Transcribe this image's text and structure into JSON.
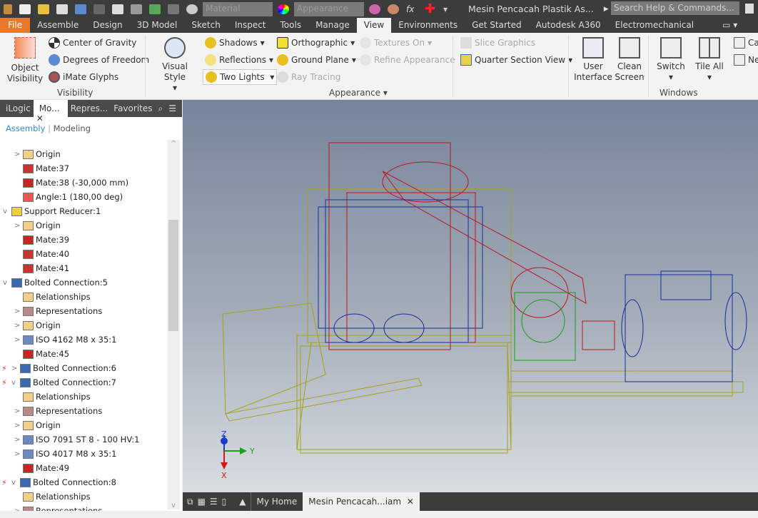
{
  "app": {
    "title": "Mesin Pencacah Plastik As...",
    "search_placeholder": "Search Help & Commands...",
    "material": "Material",
    "appearance": "Appearance"
  },
  "tabs": [
    "File",
    "Assemble",
    "Design",
    "3D Model",
    "Sketch",
    "Inspect",
    "Tools",
    "Manage",
    "View",
    "Environments",
    "Get Started",
    "Autodesk A360",
    "Electromechanical"
  ],
  "ribbon": {
    "object_visibility": "Object Visibility",
    "center_of_gravity": "Center of Gravity",
    "degrees_of_freedom": "Degrees of Freedom",
    "imate_glyphs": "iMate Glyphs",
    "visibility_group": "Visibility",
    "visual_style": "Visual Style",
    "shadows": "Shadows",
    "reflections": "Reflections",
    "two_lights": "Two Lights",
    "orthographic": "Orthographic",
    "ground_plane": "Ground Plane",
    "ray_tracing": "Ray Tracing",
    "textures_on": "Textures On",
    "refine_appearance": "Refine Appearance",
    "slice_graphics": "Slice Graphics",
    "quarter_section": "Quarter Section View",
    "appearance_group": "Appearance ▾",
    "user_interface": "User Interface",
    "clean_screen": "Clean Screen",
    "switch": "Switch",
    "tile_all": "Tile All",
    "cascade": "Ca",
    "new": "Ne",
    "windows_group": "Windows"
  },
  "browser": {
    "tabs": [
      "iLogic",
      "Mo...",
      "Repres...",
      "Favorites"
    ],
    "assembly": "Assembly",
    "modeling": "Modeling",
    "items": [
      {
        "label": "Origin",
        "level": 1,
        "icon": "folder",
        "chev": ">"
      },
      {
        "label": "Mate:37",
        "level": 1,
        "icon": "mate"
      },
      {
        "label": "Mate:38 (-30,000 mm)",
        "level": 1,
        "icon": "flush"
      },
      {
        "label": "Angle:1 (180,00 deg)",
        "level": 1,
        "icon": "angle"
      },
      {
        "label": "Support Reducer:1",
        "level": 0,
        "icon": "part",
        "chev": "v"
      },
      {
        "label": "Origin",
        "level": 1,
        "icon": "folder",
        "chev": ">"
      },
      {
        "label": "Mate:39",
        "level": 1,
        "icon": "flush"
      },
      {
        "label": "Mate:40",
        "level": 1,
        "icon": "mate"
      },
      {
        "label": "Mate:41",
        "level": 1,
        "icon": "mate"
      },
      {
        "label": "Bolted Connection:5",
        "level": 0,
        "icon": "bolt",
        "chev": "v"
      },
      {
        "label": "Relationships",
        "level": 1,
        "icon": "folder"
      },
      {
        "label": "Representations",
        "level": 1,
        "icon": "rep",
        "chev": ">"
      },
      {
        "label": "Origin",
        "level": 1,
        "icon": "folder",
        "chev": ">"
      },
      {
        "label": "ISO 4162 M8 x 35:1",
        "level": 1,
        "icon": "screw",
        "chev": ">"
      },
      {
        "label": "Mate:45",
        "level": 1,
        "icon": "flush"
      },
      {
        "label": "Bolted Connection:6",
        "level": 0,
        "icon": "bolt",
        "chev": ">",
        "warn": true
      },
      {
        "label": "Bolted Connection:7",
        "level": 0,
        "icon": "bolt",
        "chev": "v",
        "warn": true
      },
      {
        "label": "Relationships",
        "level": 1,
        "icon": "folder"
      },
      {
        "label": "Representations",
        "level": 1,
        "icon": "rep",
        "chev": ">"
      },
      {
        "label": "Origin",
        "level": 1,
        "icon": "folder",
        "chev": ">"
      },
      {
        "label": "ISO 7091 ST 8 - 100 HV:1",
        "level": 1,
        "icon": "screw",
        "chev": ">"
      },
      {
        "label": "ISO 4017 M8 x 35:1",
        "level": 1,
        "icon": "screw",
        "chev": ">"
      },
      {
        "label": "Mate:49",
        "level": 1,
        "icon": "flush"
      },
      {
        "label": "Bolted Connection:8",
        "level": 0,
        "icon": "bolt",
        "chev": "v",
        "warn": true
      },
      {
        "label": "Relationships",
        "level": 1,
        "icon": "folder"
      },
      {
        "label": "Representations",
        "level": 1,
        "icon": "rep",
        "chev": ">"
      }
    ]
  },
  "triad": {
    "z": "Z",
    "y": "Y",
    "x": "X"
  },
  "doc_tabs": {
    "home": "My Home",
    "active": "Mesin Pencacah...iam"
  },
  "colors": {
    "file_tab": "#e8782a",
    "frame": "#a6a21a",
    "cutter": "#c0141c",
    "motor": "#1a2d9c",
    "reducer": "#1c9a1c"
  }
}
